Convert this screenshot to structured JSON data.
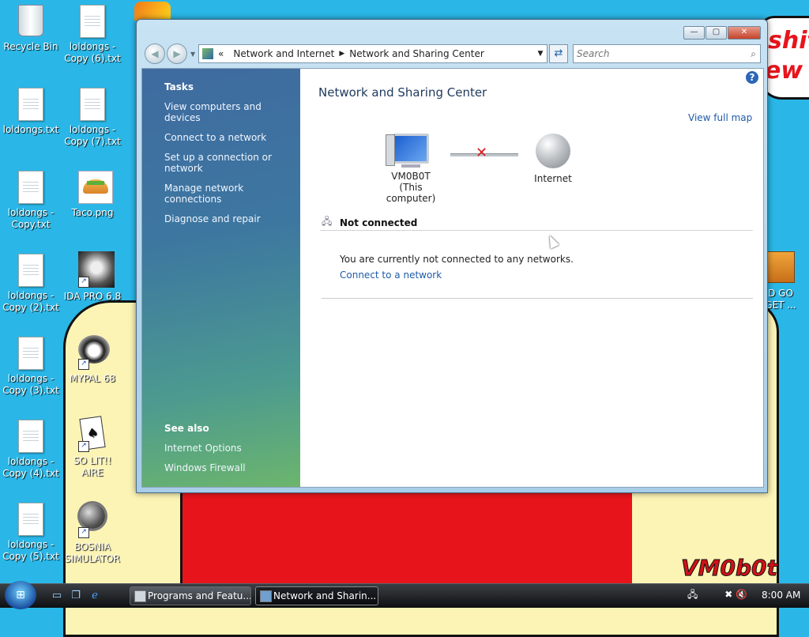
{
  "desktop": {
    "wallpaper_text": [
      "shit",
      "ew"
    ],
    "signature": "VM0b0t",
    "icons": [
      {
        "label": "Recycle Bin",
        "kind": "recycle"
      },
      {
        "label": "loldongs - Copy (6).txt",
        "kind": "file"
      },
      {
        "label": "loldongs.txt",
        "kind": "file"
      },
      {
        "label": "loldongs - Copy (7).txt",
        "kind": "file"
      },
      {
        "label": "loldongs - Copy.txt",
        "kind": "file"
      },
      {
        "label": "Taco.png",
        "kind": "image"
      },
      {
        "label": "loldongs - Copy (2).txt",
        "kind": "file"
      },
      {
        "label": "IDA PRO 6.8",
        "kind": "shortcut"
      },
      {
        "label": "loldongs - Copy (3).txt",
        "kind": "file"
      },
      {
        "label": "MYPAL 68",
        "kind": "shortcut"
      },
      {
        "label": "loldongs - Copy (4).txt",
        "kind": "file"
      },
      {
        "label": "SO LIT!! AIRE",
        "kind": "shortcut"
      },
      {
        "label": "loldongs - Copy (5).txt",
        "kind": "file"
      },
      {
        "label": "BOSNIA SIMULATOR",
        "kind": "shortcut"
      }
    ],
    "right_partial_label": "D GO\nGET ..."
  },
  "window": {
    "breadcrumb_prefix": "«",
    "breadcrumb": [
      "Network and Internet",
      "Network and Sharing Center"
    ],
    "search_placeholder": "Search",
    "sidebar": {
      "tasks_header": "Tasks",
      "tasks": [
        "View computers and devices",
        "Connect to a network",
        "Set up a connection or network",
        "Manage network connections",
        "Diagnose and repair"
      ],
      "see_also_header": "See also",
      "see_also": [
        "Internet Options",
        "Windows Firewall"
      ]
    },
    "main": {
      "title": "Network and Sharing Center",
      "view_full_map": "View full map",
      "computer_name": "VM0B0T",
      "computer_sub": "(This computer)",
      "internet_label": "Internet",
      "status_label": "Not connected",
      "message": "You are currently not connected to any networks.",
      "connect_link": "Connect to a network"
    }
  },
  "taskbar": {
    "buttons": [
      "Programs and Featu...",
      "Network and Sharin..."
    ],
    "clock": "8:00 AM"
  }
}
